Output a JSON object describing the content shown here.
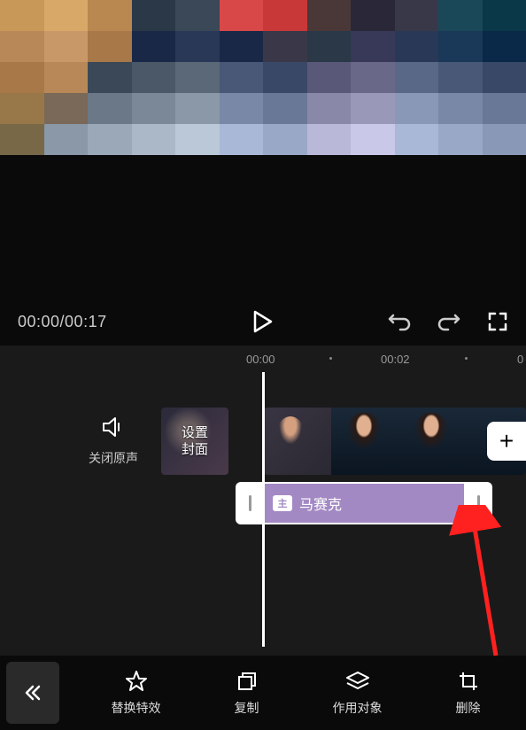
{
  "playback": {
    "current_time": "00:00",
    "total_time": "00:17",
    "time_display": "00:00/00:17"
  },
  "ruler": {
    "mark1": "00:00",
    "mark2": "00:02",
    "mark3": "0"
  },
  "mute": {
    "label": "关闭原声"
  },
  "cover": {
    "line1": "设置",
    "line2": "封面"
  },
  "effect": {
    "badge": "主",
    "label": "马赛克"
  },
  "add_button": {
    "symbol": "+"
  },
  "toolbar": {
    "replace_effect": "替换特效",
    "copy": "复制",
    "target": "作用对象",
    "delete": "删除"
  },
  "colors": {
    "effect_bg": "#a389c4",
    "arrow": "#ff2020"
  }
}
